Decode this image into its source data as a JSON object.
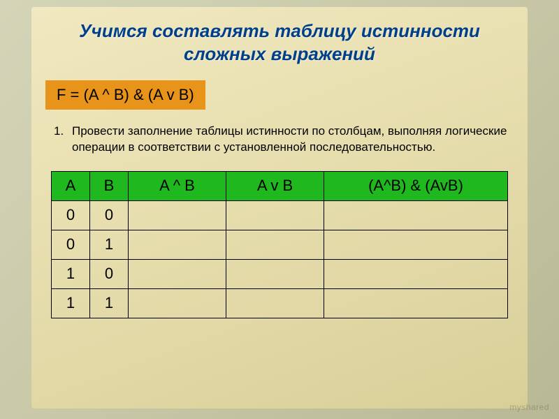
{
  "title_line1": "Учимся составлять таблицу истинности",
  "title_line2": "сложных выражений",
  "formula": "F = (A ^ B) & (A v B)",
  "instruction": {
    "number": "1.",
    "text": "Провести заполнение таблицы истинности по столбцам, выполняя логические операции в соответствии с установленной последовательностью."
  },
  "table": {
    "headers": [
      "A",
      "B",
      "A ^ B",
      "A v B",
      "(A^B) & (AvB)"
    ],
    "rows": [
      [
        "0",
        "0",
        "",
        "",
        ""
      ],
      [
        "0",
        "1",
        "",
        "",
        ""
      ],
      [
        "1",
        "0",
        "",
        "",
        ""
      ],
      [
        "1",
        "1",
        "",
        "",
        ""
      ]
    ]
  },
  "watermark": "myshared"
}
